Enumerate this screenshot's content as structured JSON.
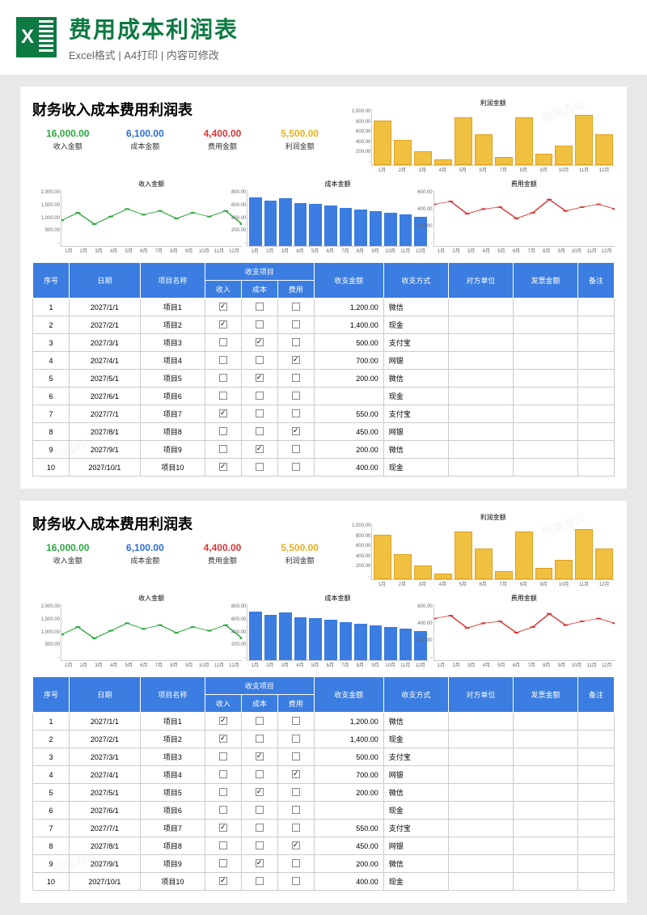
{
  "header": {
    "title": "费用成本利润表",
    "subtitle": "Excel格式 | A4打印 | 内容可修改"
  },
  "sheet_title": "财务收入成本费用利润表",
  "summary": [
    {
      "value": "16,000.00",
      "label": "收入金额",
      "cls": "c-green"
    },
    {
      "value": "6,100.00",
      "label": "成本金额",
      "cls": "c-blue"
    },
    {
      "value": "4,400.00",
      "label": "费用金额",
      "cls": "c-red"
    },
    {
      "value": "5,500.00",
      "label": "利润金额",
      "cls": "c-yellow"
    }
  ],
  "chart_data": [
    {
      "type": "bar",
      "title": "利润金额",
      "categories": [
        "1月",
        "2月",
        "3月",
        "4月",
        "5月",
        "6月",
        "7月",
        "8月",
        "9月",
        "10月",
        "11月",
        "12月"
      ],
      "values": [
        800,
        450,
        250,
        100,
        850,
        550,
        150,
        850,
        200,
        350,
        900,
        550
      ],
      "ylim": [
        0,
        1000
      ],
      "yticks": [
        "1,000.00",
        "800.00",
        "600.00",
        "400.00",
        "200.00",
        "-"
      ],
      "color": "yellow"
    },
    {
      "type": "line",
      "title": "收入金额",
      "categories": [
        "1月",
        "2月",
        "3月",
        "4月",
        "5月",
        "6月",
        "7月",
        "8月",
        "9月",
        "10月",
        "11月",
        "12月"
      ],
      "values": [
        1200,
        1400,
        1100,
        1300,
        1500,
        1350,
        1450,
        1250,
        1400,
        1300,
        1450,
        1100
      ],
      "ylim": [
        500,
        2000
      ],
      "yticks": [
        "2,000.00",
        "1,500.00",
        "1,000.00",
        "500.00",
        "-"
      ],
      "color": "green"
    },
    {
      "type": "bar",
      "title": "成本金额",
      "categories": [
        "1月",
        "2月",
        "3月",
        "4月",
        "5月",
        "6月",
        "7月",
        "8月",
        "9月",
        "10月",
        "11月",
        "12月"
      ],
      "values": [
        700,
        650,
        680,
        620,
        600,
        580,
        550,
        520,
        500,
        480,
        450,
        420
      ],
      "ylim": [
        0,
        800
      ],
      "yticks": [
        "800.00",
        "600.00",
        "400.00",
        "200.00",
        "-"
      ],
      "color": "blue"
    },
    {
      "type": "line",
      "title": "费用金额",
      "categories": [
        "1月",
        "2月",
        "3月",
        "4月",
        "5月",
        "6月",
        "7月",
        "8月",
        "9月",
        "10月",
        "11月",
        "12月"
      ],
      "values": [
        450,
        480,
        350,
        400,
        420,
        300,
        360,
        500,
        380,
        420,
        450,
        400
      ],
      "ylim": [
        0,
        600
      ],
      "yticks": [
        "600.00",
        "400.00",
        "200.00",
        "-"
      ],
      "color": "red"
    }
  ],
  "table": {
    "headers": {
      "seq": "序号",
      "date": "日期",
      "project": "项目名称",
      "group": "收支项目",
      "income": "收入",
      "cost": "成本",
      "expense": "费用",
      "amount": "收支金额",
      "method": "收支方式",
      "party": "对方单位",
      "invoice": "发票金额",
      "remark": "备注"
    },
    "rows": [
      {
        "seq": 1,
        "date": "2027/1/1",
        "project": "项目1",
        "income": true,
        "cost": false,
        "expense": false,
        "amount": "1,200.00",
        "method": "微信"
      },
      {
        "seq": 2,
        "date": "2027/2/1",
        "project": "项目2",
        "income": true,
        "cost": false,
        "expense": false,
        "amount": "1,400.00",
        "method": "现金"
      },
      {
        "seq": 3,
        "date": "2027/3/1",
        "project": "项目3",
        "income": false,
        "cost": true,
        "expense": false,
        "amount": "500.00",
        "method": "支付宝"
      },
      {
        "seq": 4,
        "date": "2027/4/1",
        "project": "项目4",
        "income": false,
        "cost": false,
        "expense": true,
        "amount": "700.00",
        "method": "网银"
      },
      {
        "seq": 5,
        "date": "2027/5/1",
        "project": "项目5",
        "income": false,
        "cost": true,
        "expense": false,
        "amount": "200.00",
        "method": "微信"
      },
      {
        "seq": 6,
        "date": "2027/6/1",
        "project": "项目6",
        "income": false,
        "cost": false,
        "expense": false,
        "amount": "",
        "method": "现金"
      },
      {
        "seq": 7,
        "date": "2027/7/1",
        "project": "项目7",
        "income": true,
        "cost": false,
        "expense": false,
        "amount": "550.00",
        "method": "支付宝"
      },
      {
        "seq": 8,
        "date": "2027/8/1",
        "project": "项目8",
        "income": false,
        "cost": false,
        "expense": true,
        "amount": "450.00",
        "method": "网银"
      },
      {
        "seq": 9,
        "date": "2027/9/1",
        "project": "项目9",
        "income": false,
        "cost": true,
        "expense": false,
        "amount": "200.00",
        "method": "微信"
      },
      {
        "seq": 10,
        "date": "2027/10/1",
        "project": "项目10",
        "income": true,
        "cost": false,
        "expense": false,
        "amount": "400.00",
        "method": "现金"
      }
    ]
  },
  "watermark": "熊猫办公"
}
